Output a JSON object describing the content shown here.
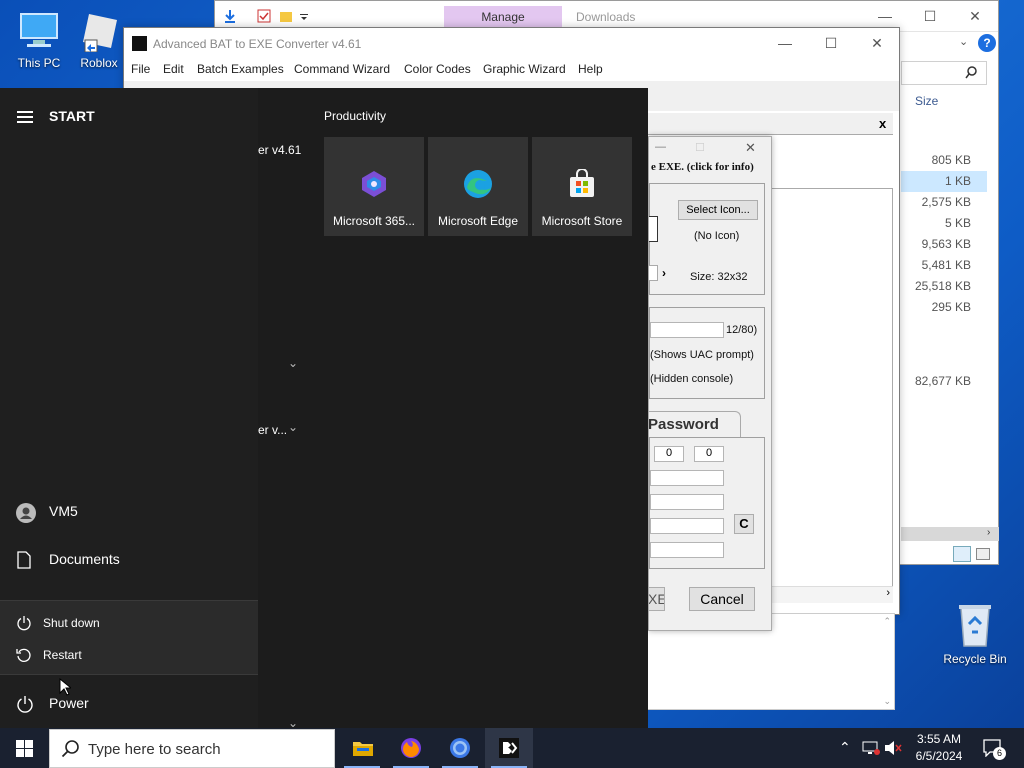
{
  "desktop": {
    "icons": [
      {
        "label": "This PC"
      },
      {
        "label": "Roblox"
      },
      {
        "label": "Recycle Bin"
      }
    ]
  },
  "explorer": {
    "manage_tab": "Manage",
    "title": "Downloads",
    "size_header": "Size",
    "sizes": [
      "805 KB",
      "1 KB",
      "2,575 KB",
      "5 KB",
      "9,563 KB",
      "5,481 KB",
      "25,518 KB",
      "295 KB",
      "82,677 KB"
    ],
    "help_label": "?"
  },
  "bat_window": {
    "title": "Advanced BAT to EXE Converter v4.61",
    "menu": [
      "File",
      "Edit",
      "Batch Examples",
      "Command Wizard",
      "Color Codes",
      "Graphic Wizard",
      "Help"
    ],
    "close_label": "x"
  },
  "dialog": {
    "info_text": "e EXE. (click for info)",
    "select_icon": "Select Icon...",
    "no_icon": "(No Icon)",
    "size_label": "Size: 32x32",
    "counter": "12/80)",
    "uac": "(Shows UAC prompt)",
    "hidden": "(Hidden console)",
    "password_tab": "Password",
    "version_fields": [
      "0",
      "0"
    ],
    "c_button": "C",
    "exe_button": "XE",
    "cancel_button": "Cancel"
  },
  "start_menu": {
    "header": "START",
    "group_title": "Productivity",
    "tiles": [
      {
        "label": "Microsoft 365..."
      },
      {
        "label": "Microsoft Edge"
      },
      {
        "label": "Microsoft Store"
      }
    ],
    "app_fragments": [
      "er v4.61",
      "er v..."
    ],
    "user": "VM5",
    "documents": "Documents",
    "power_options": [
      "Shut down",
      "Restart"
    ],
    "power": "Power"
  },
  "taskbar": {
    "search_placeholder": "Type here to search",
    "time": "3:55 AM",
    "date": "6/5/2024",
    "notification_count": "6"
  }
}
